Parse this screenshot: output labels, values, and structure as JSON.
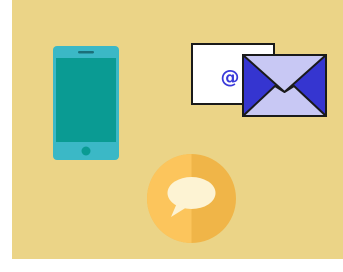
{
  "icons": {
    "phone": "smartphone-icon",
    "email": "email-envelope-icon",
    "chat": "chat-bubble-icon"
  },
  "email": {
    "at_symbol": "@"
  },
  "colors": {
    "background": "#ebd487",
    "phone_body": "#3bb8c6",
    "phone_screen": "#0a9b93",
    "letter_paper": "#ffffff",
    "at_symbol": "#3a3ad9",
    "envelope_body": "#3535d0",
    "envelope_flap": "#c8c8f4",
    "chat_circle_light": "#fcc55c",
    "chat_circle_dark": "#f0b548",
    "chat_bubble": "#fdf3d3",
    "outline": "#1a1a1a"
  }
}
